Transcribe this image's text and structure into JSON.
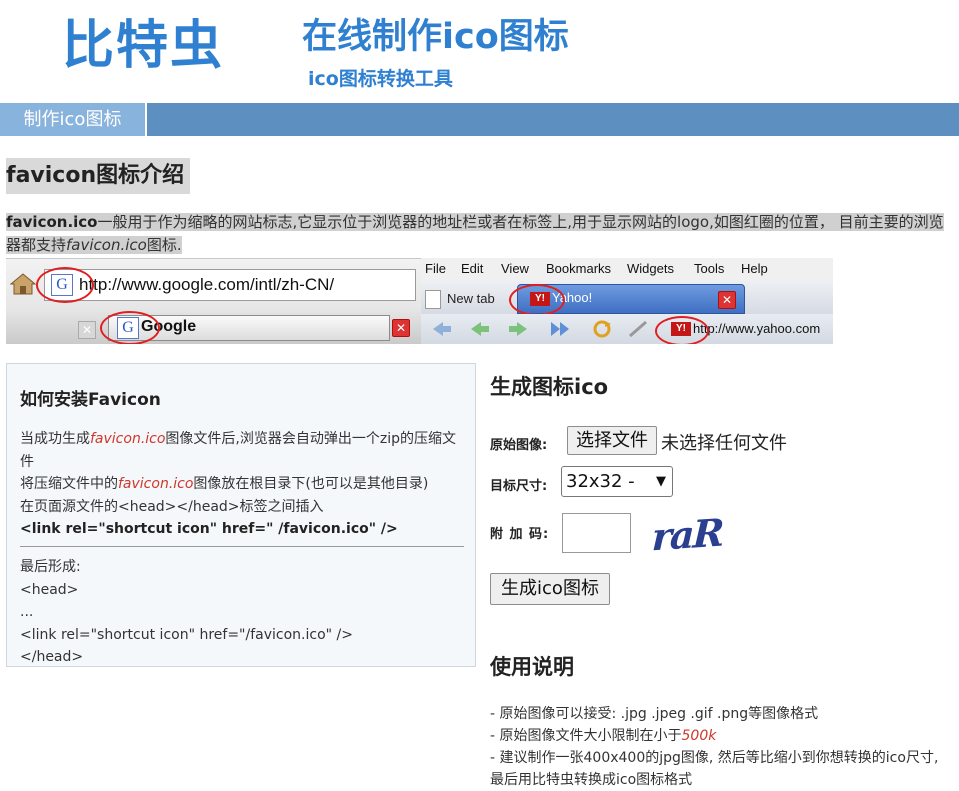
{
  "header": {
    "logo": "比特虫",
    "title": "在线制作ico图标",
    "subtitle": "ico图标转换工具"
  },
  "nav": {
    "tab_label": "制作ico图标"
  },
  "intro": {
    "heading": "favicon图标介绍",
    "bold_term": "favicon.ico",
    "text": "一般用于作为缩略的网站标志,它显示位于浏览器的地址栏或者在标签上,用于显示网站的logo,如图红圈的位置， 目前主要的浏览器都支持",
    "italic_term": "favicon.ico",
    "text_end": "图标."
  },
  "illustration": {
    "google_url": "http://www.google.com/intl/zh-CN/",
    "google_tab": "Google",
    "google_icon": "G",
    "menu": [
      "File",
      "Edit",
      "View",
      "Bookmarks",
      "Widgets",
      "Tools",
      "Help"
    ],
    "new_tab": "New tab",
    "yahoo_tab": "Yahoo!",
    "yahoo_badge": "Y!",
    "yahoo_url": "http://www.yahoo.com"
  },
  "install": {
    "heading": "如何安装Favicon",
    "line1_a": "当成功生成",
    "line1_em": "favicon.ico",
    "line1_b": "图像文件后,浏览器会自动弹出一个zip的压缩文件",
    "line2_a": "将压缩文件中的",
    "line2_em": "favicon.ico",
    "line2_b": "图像放在根目录下(也可以是其他目录)",
    "line3": "在页面源文件的<head></head>标签之间插入",
    "line4": "<link rel=\"shortcut icon\" href=\" /favicon.ico\" />",
    "final_label": "最后形成:",
    "final_1": "<head>",
    "final_2": "...",
    "final_3": "<link rel=\"shortcut icon\" href=\"/favicon.ico\" />",
    "final_4": "</head>"
  },
  "form": {
    "heading": "生成图标ico",
    "source_label": "原始图像:",
    "choose_button": "选择文件",
    "no_file": "未选择任何文件",
    "size_label": "目标尺寸:",
    "size_selected": "32x32 -",
    "code_label": "附 加 码:",
    "captcha_text": "raR",
    "submit_button": "生成ico图标"
  },
  "usage": {
    "heading": "使用说明",
    "item1": "- 原始图像可以接受: .jpg .jpeg .gif .png等图像格式",
    "item2_a": "- 原始图像文件大小限制在小于",
    "item2_em": "500k",
    "item3": "- 建议制作一张400x400的jpg图像, 然后等比缩小到你想转换的ico尺寸,最后用比特虫转换成ico图标格式"
  },
  "colors": {
    "brand_blue": "#2f80d1",
    "nav_bar": "#5d8fc0",
    "nav_tab": "#88b3dc",
    "accent_red": "#d0362a"
  }
}
